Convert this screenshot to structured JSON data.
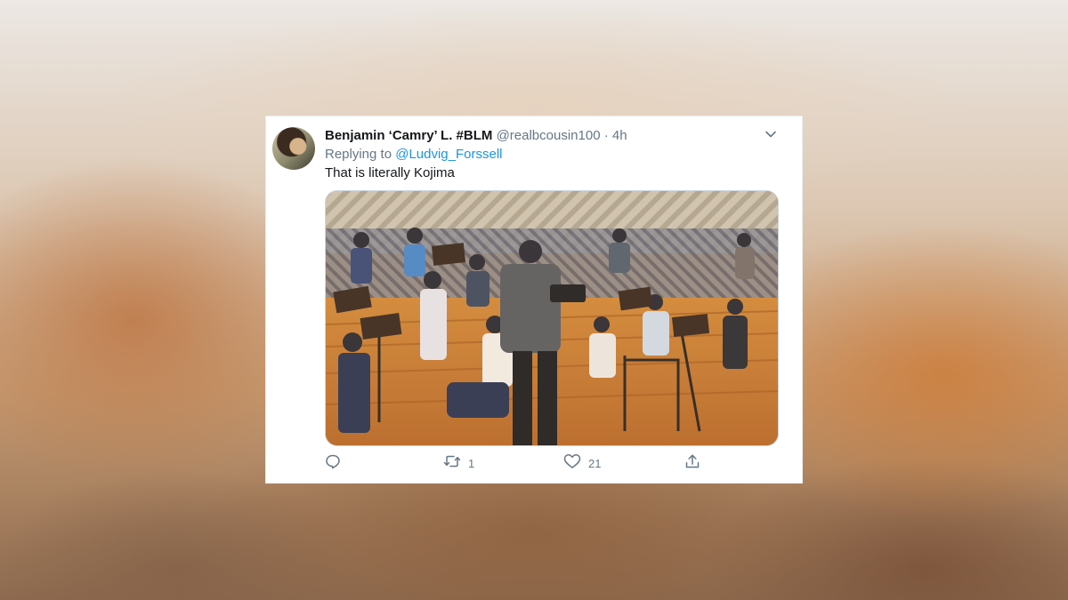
{
  "tweet": {
    "display_name": "Benjamin ‘Camry’ L. #BLM",
    "handle": "@realbcousin100",
    "separator": "·",
    "time": "4h",
    "replying_prefix": "Replying to",
    "replying_to": "@Ludvig_Forssell",
    "text": "That is literally Kojima",
    "media_icon": "photo-of-orchestra-rehearsal",
    "actions": {
      "reply_icon": "reply-icon",
      "retweet_icon": "retweet-icon",
      "retweet_count": "1",
      "like_icon": "heart-icon",
      "like_count": "21",
      "share_icon": "share-icon"
    },
    "menu_icon": "chevron-down-icon"
  },
  "colors": {
    "text_primary": "#14171a",
    "text_secondary": "#657786",
    "link": "#1b95e0",
    "card_bg": "#ffffff"
  }
}
